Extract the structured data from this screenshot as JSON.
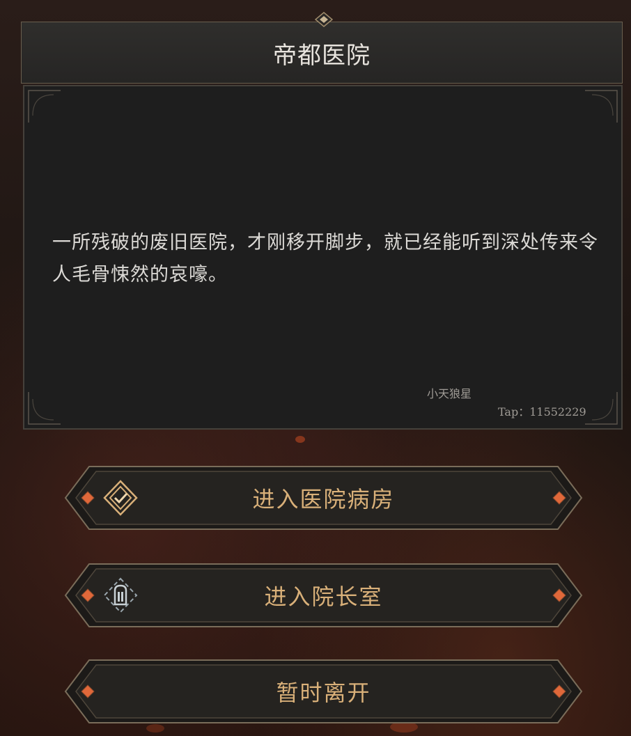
{
  "dialog": {
    "title": "帝都医院",
    "description": "一所残破的废旧医院，才刚移开脚步，就已经能听到深处传来令人毛骨悚然的哀嚎。",
    "watermark_name": "小天狼星",
    "watermark_tap": "Tap：11552229"
  },
  "choices": [
    {
      "label": "进入医院病房",
      "icon": "diamond-check-icon"
    },
    {
      "label": "进入院长室",
      "icon": "door-icon"
    },
    {
      "label": "暂时离开",
      "icon": ""
    }
  ],
  "colors": {
    "choice_text": "#d9b079",
    "gem_orange": "#e0683a",
    "panel_bg": "#1e1e1e",
    "frame_gold": "#6a5f4f"
  }
}
